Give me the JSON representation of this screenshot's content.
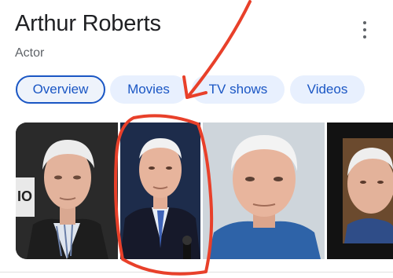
{
  "header": {
    "title": "Arthur Roberts",
    "subtitle": "Actor"
  },
  "tabs": [
    {
      "label": "Overview",
      "selected": true
    },
    {
      "label": "Movies",
      "selected": false
    },
    {
      "label": "TV shows",
      "selected": false
    },
    {
      "label": "Videos",
      "selected": false
    }
  ],
  "icons": {
    "more": "more-vert-icon"
  },
  "photos": [
    {
      "subject": "older man with white hair, dark jacket, striped shirt"
    },
    {
      "subject": "older man in dark suit and blue tie at microphone (circled)"
    },
    {
      "subject": "older man with white hair, blue shirt, light background"
    },
    {
      "subject": "older man with white hair, dark background"
    }
  ],
  "colors": {
    "accent": "#1a56c4",
    "chip_bg": "#e8f0fe",
    "annotation": "#e8402a"
  }
}
